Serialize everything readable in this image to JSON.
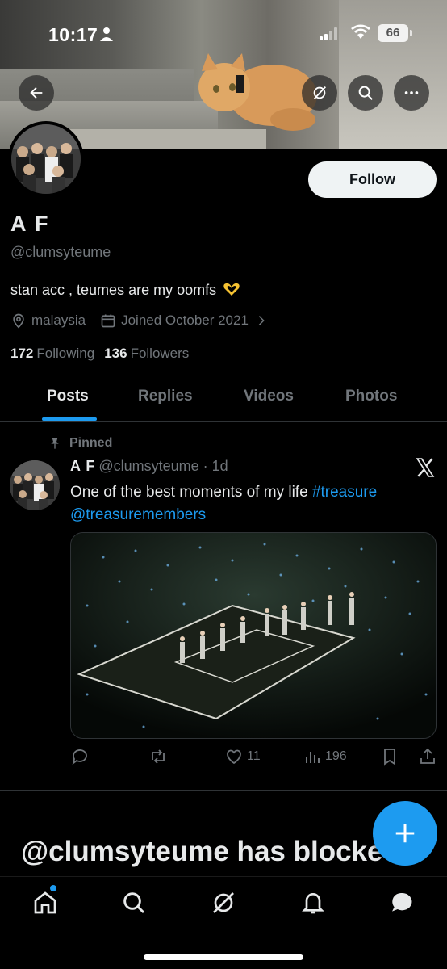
{
  "status_bar": {
    "time": "10:17",
    "battery": "66"
  },
  "profile": {
    "name": "A F",
    "handle": "@clumsyteume",
    "bio": "stan acc , teumes are my oomfs",
    "location": "malaysia",
    "joined": "Joined October 2021",
    "following_count": "172",
    "following_label": "Following",
    "followers_count": "136",
    "followers_label": "Followers",
    "follow_button": "Follow"
  },
  "tabs": [
    {
      "label": "Posts",
      "active": true
    },
    {
      "label": "Replies",
      "active": false
    },
    {
      "label": "Videos",
      "active": false
    },
    {
      "label": "Photos",
      "active": false
    }
  ],
  "post": {
    "pinned_label": "Pinned",
    "author_name": "A F",
    "author_handle": "@clumsyteume",
    "time": "· 1d",
    "text_prefix": "One of the best moments of my life ",
    "hashtag": "#treasure",
    "mention": "@treasuremembers",
    "replies": "",
    "reposts": "",
    "likes": "11",
    "views": "196"
  },
  "blocked_text": "@clumsyteume has blocke",
  "icons": {
    "back": "arrow-left-icon",
    "grok": "grok-icon",
    "search": "search-icon",
    "more": "more-icon",
    "location": "location-pin-icon",
    "calendar": "calendar-icon",
    "pin": "pin-icon",
    "x_logo": "x-logo-icon",
    "compose": "plus-icon",
    "nav": [
      "home-icon",
      "search-icon",
      "grok-icon",
      "bell-icon",
      "chat-icon"
    ]
  },
  "colors": {
    "accent": "#1d9bf0",
    "background": "#000000",
    "muted": "#71767b"
  }
}
